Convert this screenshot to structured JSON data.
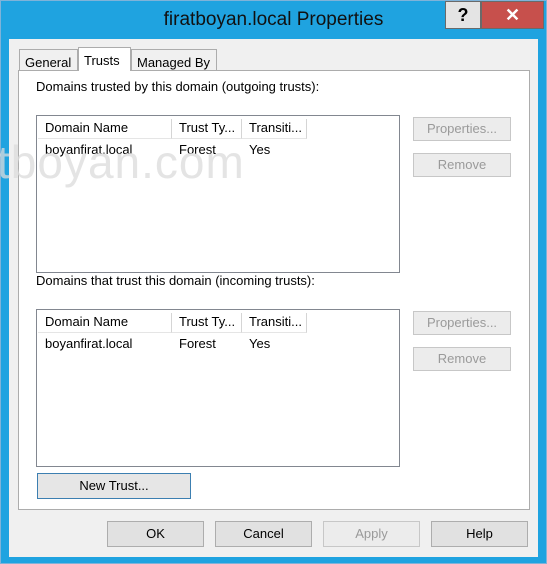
{
  "window": {
    "title": "firatboyan.local Properties",
    "help_glyph": "?",
    "close_glyph": "✕"
  },
  "tabs": [
    {
      "label": "General"
    },
    {
      "label": "Trusts"
    },
    {
      "label": "Managed By"
    }
  ],
  "outgoing": {
    "heading": "Domains trusted by this domain (outgoing trusts):",
    "columns": [
      "Domain Name",
      "Trust Ty...",
      "Transiti..."
    ],
    "rows": [
      {
        "domain": "boyanfirat.local",
        "type": "Forest",
        "transitive": "Yes"
      }
    ],
    "properties_label": "Properties...",
    "remove_label": "Remove"
  },
  "incoming": {
    "heading": "Domains that trust this domain (incoming trusts):",
    "columns": [
      "Domain Name",
      "Trust Ty...",
      "Transiti..."
    ],
    "rows": [
      {
        "domain": "boyanfirat.local",
        "type": "Forest",
        "transitive": "Yes"
      }
    ],
    "properties_label": "Properties...",
    "remove_label": "Remove"
  },
  "new_trust_label": "New Trust...",
  "footer": {
    "ok": "OK",
    "cancel": "Cancel",
    "apply": "Apply",
    "help": "Help"
  },
  "watermark": "tboyan.com",
  "colors": {
    "titlebar": "#1fa3e0",
    "close": "#c7504c"
  }
}
